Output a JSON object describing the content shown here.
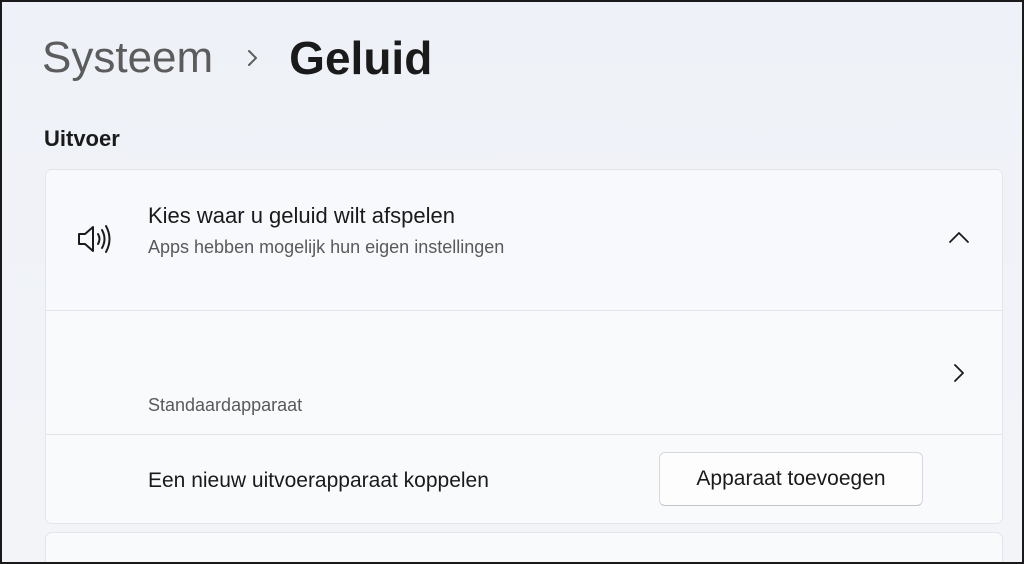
{
  "breadcrumb": {
    "parent": "Systeem",
    "current": "Geluid"
  },
  "output": {
    "section_title": "Uitvoer",
    "device_choice": {
      "title": "Kies waar u geluid wilt afspelen",
      "subtitle": "Apps hebben mogelijk hun eigen instellingen",
      "icon": "speaker-icon",
      "expand_icon": "chevron-up-icon"
    },
    "default_device": {
      "label": "Standaardapparaat",
      "icon": "chevron-right-icon"
    },
    "pair_device": {
      "label": "Een nieuw uitvoerapparaat koppelen",
      "button_label": "Apparaat toevoegen"
    }
  }
}
